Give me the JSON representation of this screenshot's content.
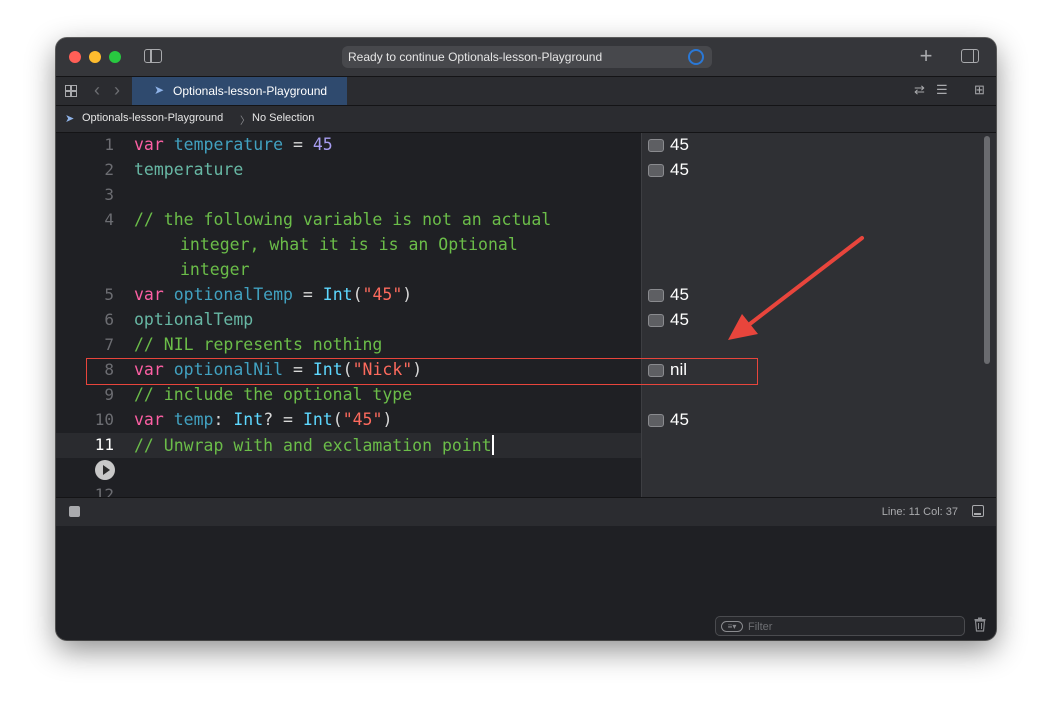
{
  "titlebar": {
    "status": "Ready to continue Optionals-lesson-Playground"
  },
  "tab": {
    "label": "Optionals-lesson-Playground"
  },
  "breadcrumb": {
    "project": "Optionals-lesson-Playground",
    "selection": "No Selection"
  },
  "editor": {
    "lines": [
      {
        "num": "1"
      },
      {
        "num": "2"
      },
      {
        "num": "3"
      },
      {
        "num": "4"
      },
      {
        "num": "5"
      },
      {
        "num": "6"
      },
      {
        "num": "7"
      },
      {
        "num": "8"
      },
      {
        "num": "9"
      },
      {
        "num": "10"
      },
      {
        "num": "11"
      },
      {
        "num": "12"
      }
    ],
    "code": {
      "l1_kw": "var",
      "l1_name": "temperature",
      "l1_op": " = ",
      "l1_val": "45",
      "l2": "temperature",
      "l4a": "// the following variable is not an actual",
      "l4b": "integer, what it is is an Optional",
      "l4c": "integer",
      "l5_kw": "var",
      "l5_name": "optionalTemp",
      "l5_op": " = ",
      "l5_type": "Int",
      "l5_open": "(",
      "l5_str": "\"45\"",
      "l5_close": ")",
      "l6": "optionalTemp",
      "l7": "// NIL represents nothing",
      "l8_kw": "var",
      "l8_name": "optionalNil",
      "l8_op": " = ",
      "l8_type": "Int",
      "l8_open": "(",
      "l8_str": "\"Nick\"",
      "l8_close": ")",
      "l9": "// include the optional type",
      "l10_kw": "var",
      "l10_name": "temp",
      "l10_colon": ": ",
      "l10_type": "Int",
      "l10_q": "? = ",
      "l10_type2": "Int",
      "l10_open": "(",
      "l10_str": "\"45\"",
      "l10_close": ")",
      "l11": "// Unwrap with and exclamation point"
    }
  },
  "results": {
    "r1": "45",
    "r2": "45",
    "r5": "45",
    "r6": "45",
    "r8": "nil",
    "r10": "45"
  },
  "debugbar": {
    "line_col": "Line: 11  Col: 37"
  },
  "console": {
    "filter_placeholder": "Filter"
  },
  "colors": {
    "keyword": "#fc5fa3",
    "comment": "#6bbd49",
    "number": "#a79df1",
    "type": "#5dd8ff",
    "string": "#fc6a5d",
    "highlight": "#e8453c"
  }
}
